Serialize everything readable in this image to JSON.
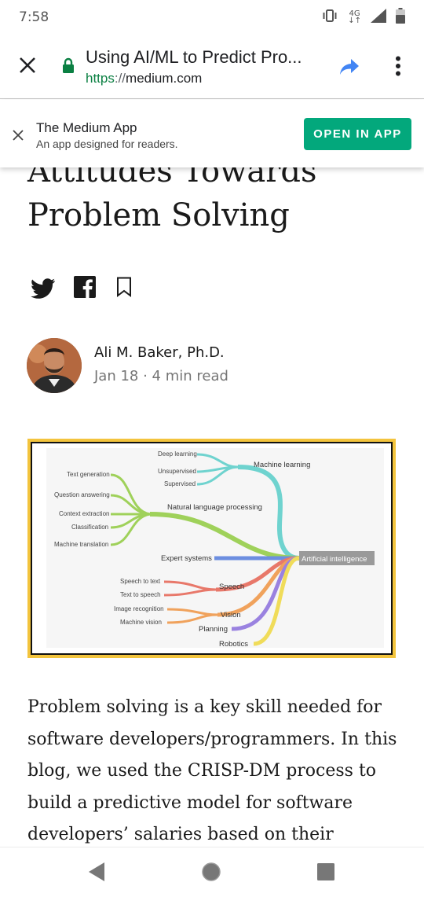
{
  "status_bar": {
    "time": "7:58",
    "network": "4G"
  },
  "browser": {
    "page_title": "Using AI/ML to Predict Pro...",
    "url_scheme": "https",
    "url_separator": "://",
    "url_host": "medium.com"
  },
  "banner": {
    "title": "The Medium App",
    "subtitle": "An app designed for readers.",
    "open_label": "OPEN IN APP",
    "accent": "#03a87c"
  },
  "article": {
    "headline": "Attitudes Towards Problem Solving",
    "author_name": "Ali M. Baker, Ph.D.",
    "author_meta": "Jan 18 · 4 min read",
    "body_text": "Problem solving is a key skill needed for software developers/programmers. In this blog, we used the CRISP-DM process to build a predictive model for software developers’ salaries based on their"
  },
  "figure": {
    "labels": {
      "deep_learning": "Deep learning",
      "unsupervised": "Unsupervised",
      "supervised": "Supervised",
      "machine_learning": "Machine learning",
      "text_generation": "Text generation",
      "question_answering": "Question answering",
      "context_extraction": "Context extraction",
      "classification": "Classification",
      "machine_translation": "Machine translation",
      "nlp": "Natural language processing",
      "expert_systems": "Expert systems",
      "ai": "Artificial intelligence",
      "speech_to_text": "Speech to text",
      "text_to_speech": "Text to speech",
      "speech": "Speech",
      "image_recognition": "Image recognition",
      "machine_vision": "Machine vision",
      "vision": "Vision",
      "planning": "Planning",
      "robotics": "Robotics"
    },
    "colors": {
      "ml": "#6fd3cf",
      "nlp": "#9fd15a",
      "expert": "#6c8ee0",
      "speech": "#e8786a",
      "vision": "#f0a25c",
      "planning": "#9a82e0",
      "robotics": "#f0dc5a",
      "frame": "#f3c43d"
    }
  },
  "icons": {
    "close_tab": "close-icon",
    "lock": "lock-icon",
    "share": "share-icon",
    "menu": "more-vert-icon",
    "twitter": "twitter-icon",
    "facebook": "facebook-icon",
    "bookmark": "bookmark-icon"
  }
}
